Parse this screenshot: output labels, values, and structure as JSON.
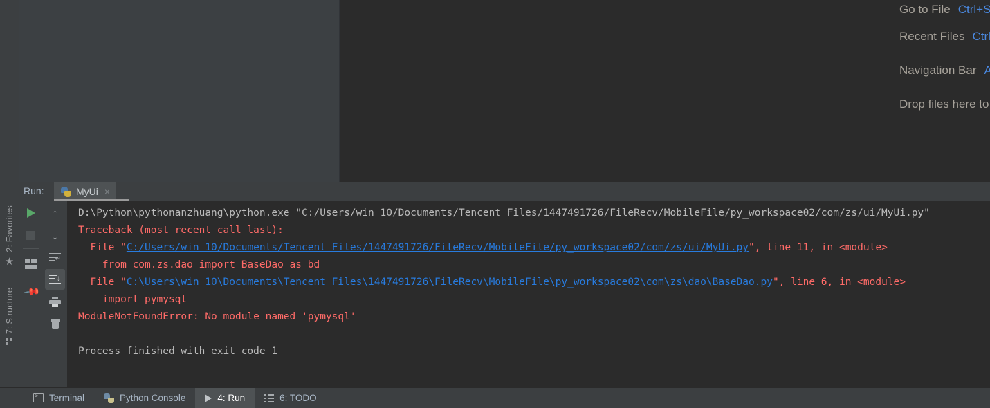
{
  "editor": {
    "placeholder_rows": [
      {
        "label": "Go to File",
        "shortcut": "Ctrl+Shift+N"
      },
      {
        "label": "Recent Files",
        "shortcut": "Ctrl+E"
      },
      {
        "label": "Navigation Bar",
        "shortcut": "Alt+Home"
      },
      {
        "label": "Drop files here to open",
        "shortcut": ""
      }
    ]
  },
  "run_window": {
    "label": "Run:",
    "tab": {
      "name": "MyUi",
      "icon": "python-icon",
      "close": "×"
    },
    "toolbar_primary": [
      {
        "name": "rerun-button",
        "icon": "play-icon"
      },
      {
        "name": "stop-button",
        "icon": "stop-icon"
      },
      {
        "name": "layout-button",
        "icon": "layout-icon"
      },
      {
        "name": "pin-tab-button",
        "icon": "pin-icon"
      }
    ],
    "toolbar_secondary": [
      {
        "name": "up-the-stack-button",
        "icon": "arrow-up-icon"
      },
      {
        "name": "down-the-stack-button",
        "icon": "arrow-down-icon"
      },
      {
        "name": "soft-wrap-button",
        "icon": "soft-wrap-icon"
      },
      {
        "name": "scroll-to-end-button",
        "icon": "scroll-to-end-icon",
        "active": true
      },
      {
        "name": "print-button",
        "icon": "printer-icon"
      },
      {
        "name": "clear-all-button",
        "icon": "trash-icon"
      }
    ],
    "console": {
      "lines": [
        [
          {
            "t": "D:\\Python\\pythonanzhuang\\python.exe \"C:/Users/win 10/Documents/Tencent Files/1447491726/FileRecv/MobileFile/py_workspace02/com/zs/ui/MyUi.py\"",
            "s": "white"
          }
        ],
        [
          {
            "t": "Traceback (most recent call last):",
            "s": "red"
          }
        ],
        [
          {
            "t": "  File \"",
            "s": "red"
          },
          {
            "t": "C:/Users/win 10/Documents/Tencent Files/1447491726/FileRecv/MobileFile/py_workspace02/com/zs/ui/MyUi.py",
            "s": "link"
          },
          {
            "t": "\", line 11, in <module>",
            "s": "red"
          }
        ],
        [
          {
            "t": "    from com.zs.dao import BaseDao as bd",
            "s": "red"
          }
        ],
        [
          {
            "t": "  File \"",
            "s": "red"
          },
          {
            "t": "C:\\Users\\win 10\\Documents\\Tencent Files\\1447491726\\FileRecv\\MobileFile\\py_workspace02\\com\\zs\\dao\\BaseDao.py",
            "s": "link"
          },
          {
            "t": "\", line 6, in <module>",
            "s": "red"
          }
        ],
        [
          {
            "t": "    import pymysql",
            "s": "red"
          }
        ],
        [
          {
            "t": "ModuleNotFoundError: No module named 'pymysql'",
            "s": "red"
          }
        ],
        [
          {
            "t": "",
            "s": "white"
          }
        ],
        [
          {
            "t": "Process finished with exit code 1",
            "s": "white"
          }
        ]
      ]
    }
  },
  "left_tool_strip": [
    {
      "num": "2",
      "label": ": Favorites",
      "icon": "star-icon"
    },
    {
      "num": "7",
      "label": ": Structure",
      "icon": "grid-icon"
    }
  ],
  "statusbar": {
    "tabs": [
      {
        "icon": "terminal-icon",
        "num": "",
        "label": "Terminal",
        "active": false
      },
      {
        "icon": "python-console-icon",
        "num": "",
        "label": "Python Console",
        "active": false
      },
      {
        "icon": "run-triangle-icon",
        "num": "4",
        "label": ": Run",
        "active": true
      },
      {
        "icon": "todo-list-icon",
        "num": "6",
        "label": ": TODO",
        "active": false
      }
    ]
  },
  "colors": {
    "panel_bg": "#3c3f41",
    "editor_bg": "#2b2b2b",
    "accent_blue": "#4a88df",
    "link_blue": "#287bde",
    "error_red": "#ff6b68",
    "text_gray": "#a9b7c6",
    "run_green": "#59a869"
  }
}
